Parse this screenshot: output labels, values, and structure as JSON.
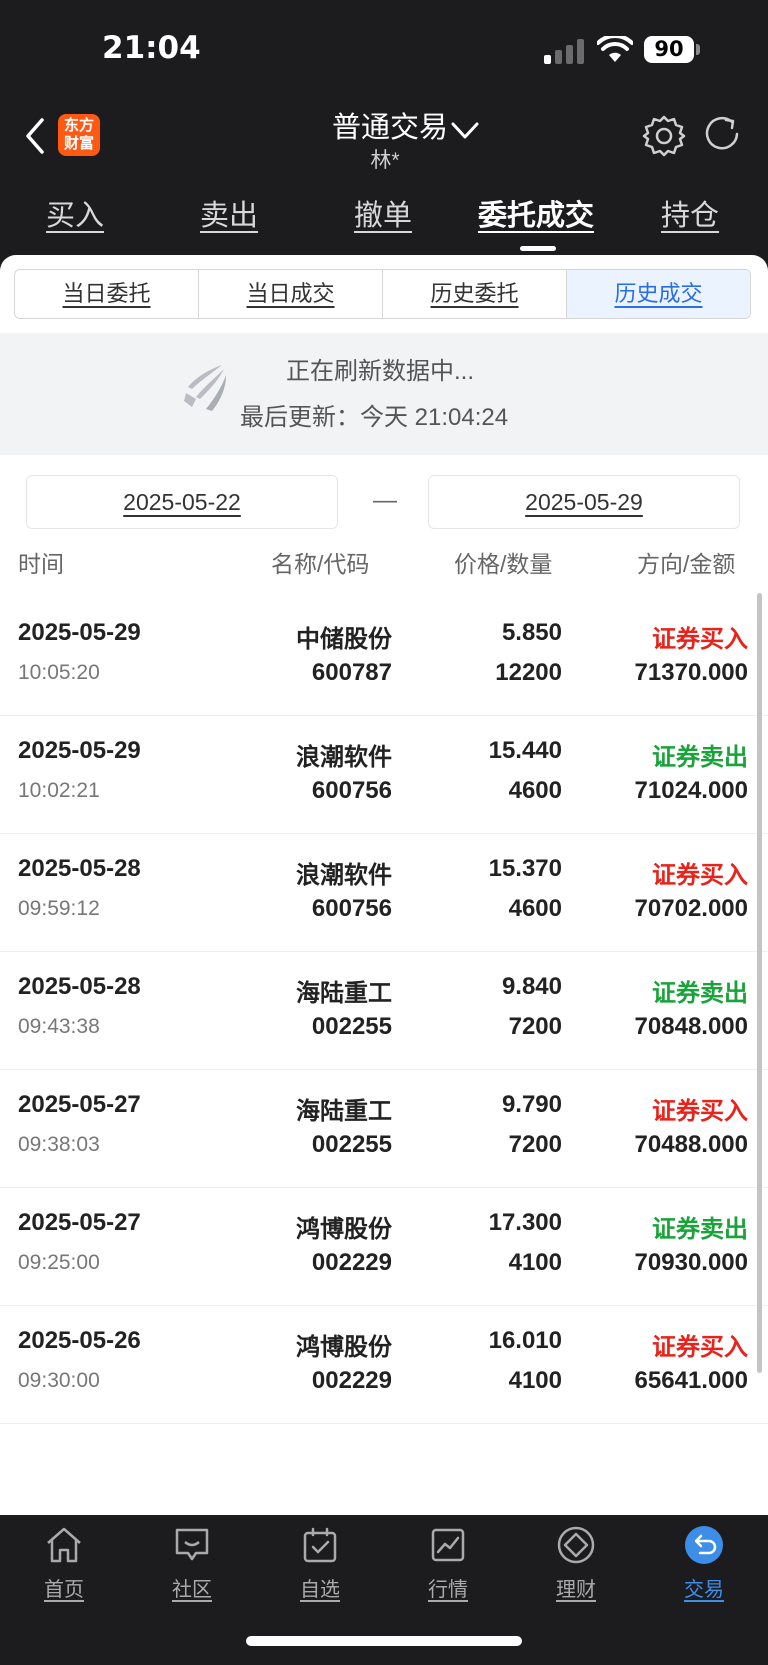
{
  "status_bar": {
    "time": "21:04",
    "battery": "90"
  },
  "header": {
    "logo_text": "东方\n财富",
    "title": "普通交易",
    "account": "林*"
  },
  "top_tabs": [
    {
      "label": "买入",
      "active": false
    },
    {
      "label": "卖出",
      "active": false
    },
    {
      "label": "撤单",
      "active": false
    },
    {
      "label": "委托成交",
      "active": true
    },
    {
      "label": "持仓",
      "active": false
    }
  ],
  "sub_tabs": [
    {
      "label": "当日委托",
      "active": false
    },
    {
      "label": "当日成交",
      "active": false
    },
    {
      "label": "历史委托",
      "active": false
    },
    {
      "label": "历史成交",
      "active": true
    }
  ],
  "refresh_banner": {
    "status": "正在刷新数据中...",
    "last_update": "最后更新：今天 21:04:24"
  },
  "date_range": {
    "start": "2025-05-22",
    "separator": "—",
    "end": "2025-05-29"
  },
  "columns": {
    "time": "时间",
    "name_code": "名称/代码",
    "price_qty": "价格/数量",
    "dir_amount": "方向/金额"
  },
  "colors": {
    "buy": "#e8231b",
    "sell": "#1aa33a",
    "accent": "#2a6ee6"
  },
  "trades": [
    {
      "date": "2025-05-29",
      "time": "10:05:20",
      "name": "中储股份",
      "code": "600787",
      "price": "5.850",
      "qty": "12200",
      "direction": "证券买入",
      "side": "buy",
      "amount": "71370.000"
    },
    {
      "date": "2025-05-29",
      "time": "10:02:21",
      "name": "浪潮软件",
      "code": "600756",
      "price": "15.440",
      "qty": "4600",
      "direction": "证券卖出",
      "side": "sell",
      "amount": "71024.000"
    },
    {
      "date": "2025-05-28",
      "time": "09:59:12",
      "name": "浪潮软件",
      "code": "600756",
      "price": "15.370",
      "qty": "4600",
      "direction": "证券买入",
      "side": "buy",
      "amount": "70702.000"
    },
    {
      "date": "2025-05-28",
      "time": "09:43:38",
      "name": "海陆重工",
      "code": "002255",
      "price": "9.840",
      "qty": "7200",
      "direction": "证券卖出",
      "side": "sell",
      "amount": "70848.000"
    },
    {
      "date": "2025-05-27",
      "time": "09:38:03",
      "name": "海陆重工",
      "code": "002255",
      "price": "9.790",
      "qty": "7200",
      "direction": "证券买入",
      "side": "buy",
      "amount": "70488.000"
    },
    {
      "date": "2025-05-27",
      "time": "09:25:00",
      "name": "鸿博股份",
      "code": "002229",
      "price": "17.300",
      "qty": "4100",
      "direction": "证券卖出",
      "side": "sell",
      "amount": "70930.000"
    },
    {
      "date": "2025-05-26",
      "time": "09:30:00",
      "name": "鸿博股份",
      "code": "002229",
      "price": "16.010",
      "qty": "4100",
      "direction": "证券买入",
      "side": "buy",
      "amount": "65641.000"
    }
  ],
  "bottom_nav": [
    {
      "label": "首页",
      "icon": "home-icon",
      "active": false
    },
    {
      "label": "社区",
      "icon": "community-icon",
      "active": false
    },
    {
      "label": "自选",
      "icon": "watchlist-icon",
      "active": false
    },
    {
      "label": "行情",
      "icon": "market-icon",
      "active": false
    },
    {
      "label": "理财",
      "icon": "wealth-icon",
      "active": false
    },
    {
      "label": "交易",
      "icon": "trade-icon",
      "active": true
    }
  ]
}
